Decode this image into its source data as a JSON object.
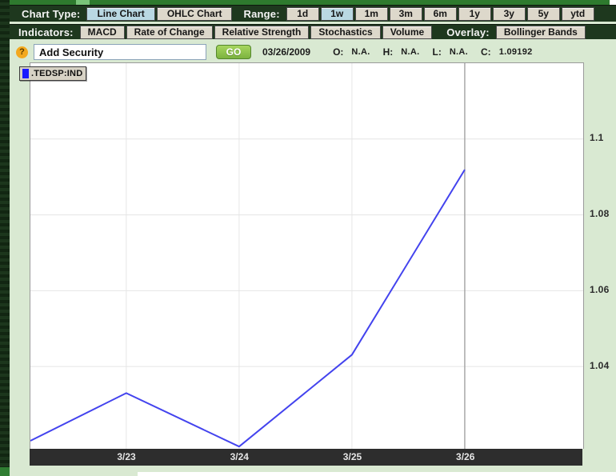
{
  "toolbar1": {
    "chart_type_label": "Chart Type:",
    "chart_type_buttons": [
      {
        "label": "Line Chart",
        "selected": true
      },
      {
        "label": "OHLC Chart",
        "selected": false
      }
    ],
    "range_label": "Range:",
    "range_buttons": [
      {
        "label": "1d",
        "selected": false
      },
      {
        "label": "1w",
        "selected": true
      },
      {
        "label": "1m",
        "selected": false
      },
      {
        "label": "3m",
        "selected": false
      },
      {
        "label": "6m",
        "selected": false
      },
      {
        "label": "1y",
        "selected": false
      },
      {
        "label": "3y",
        "selected": false
      },
      {
        "label": "5y",
        "selected": false
      },
      {
        "label": "ytd",
        "selected": false
      }
    ]
  },
  "toolbar2": {
    "indicators_label": "Indicators:",
    "indicator_buttons": [
      "MACD",
      "Rate of Change",
      "Relative Strength",
      "Stochastics",
      "Volume"
    ],
    "overlay_label": "Overlay:",
    "overlay_buttons": [
      "Bollinger Bands"
    ]
  },
  "toolbar3": {
    "help_icon_glyph": "?",
    "security_input_value": "Add Security",
    "go_label": "GO",
    "quote": {
      "date": "03/26/2009",
      "o_label": "O:",
      "o_value": "N.A.",
      "h_label": "H:",
      "h_value": "N.A.",
      "l_label": "L:",
      "l_value": "N.A.",
      "c_label": "C:",
      "c_value": "1.09192"
    }
  },
  "legend": {
    "symbol": ".TEDSP:IND",
    "swatch_color": "#1a1aff"
  },
  "chart_data": {
    "type": "line",
    "title": "",
    "xlabel": "",
    "ylabel": "",
    "x_ticks": [
      0,
      1,
      2,
      3
    ],
    "x_tick_labels": [
      "3/23",
      "3/24",
      "3/25",
      "3/26"
    ],
    "current_x_tick": 3,
    "y_ticks": [
      1.1,
      1.08,
      1.06,
      1.04
    ],
    "y_tick_labels": [
      "1.1",
      "1.08",
      "1.06",
      "1.04"
    ],
    "xlim": [
      -0.85,
      4.05
    ],
    "ylim": [
      1.0183,
      1.12
    ],
    "grid": true,
    "legend_position": "top-left",
    "series": [
      {
        "name": ".TEDSP:IND",
        "color": "#4343ee",
        "x": [
          -0.85,
          0,
          1,
          2,
          3
        ],
        "values": [
          1.0204,
          1.033,
          1.0189,
          1.0431,
          1.09192
        ]
      }
    ],
    "last_close": "1.09192"
  },
  "colors": {
    "toolbar_green": "#1e381e",
    "page_green": "#d9e9d2",
    "button_beige": "#ddd8cb",
    "selected_blue": "#b9d8e2",
    "go_green": "#7cb33f",
    "line_blue": "#4343ee",
    "axis_bar_dark": "#2d2d2d"
  }
}
